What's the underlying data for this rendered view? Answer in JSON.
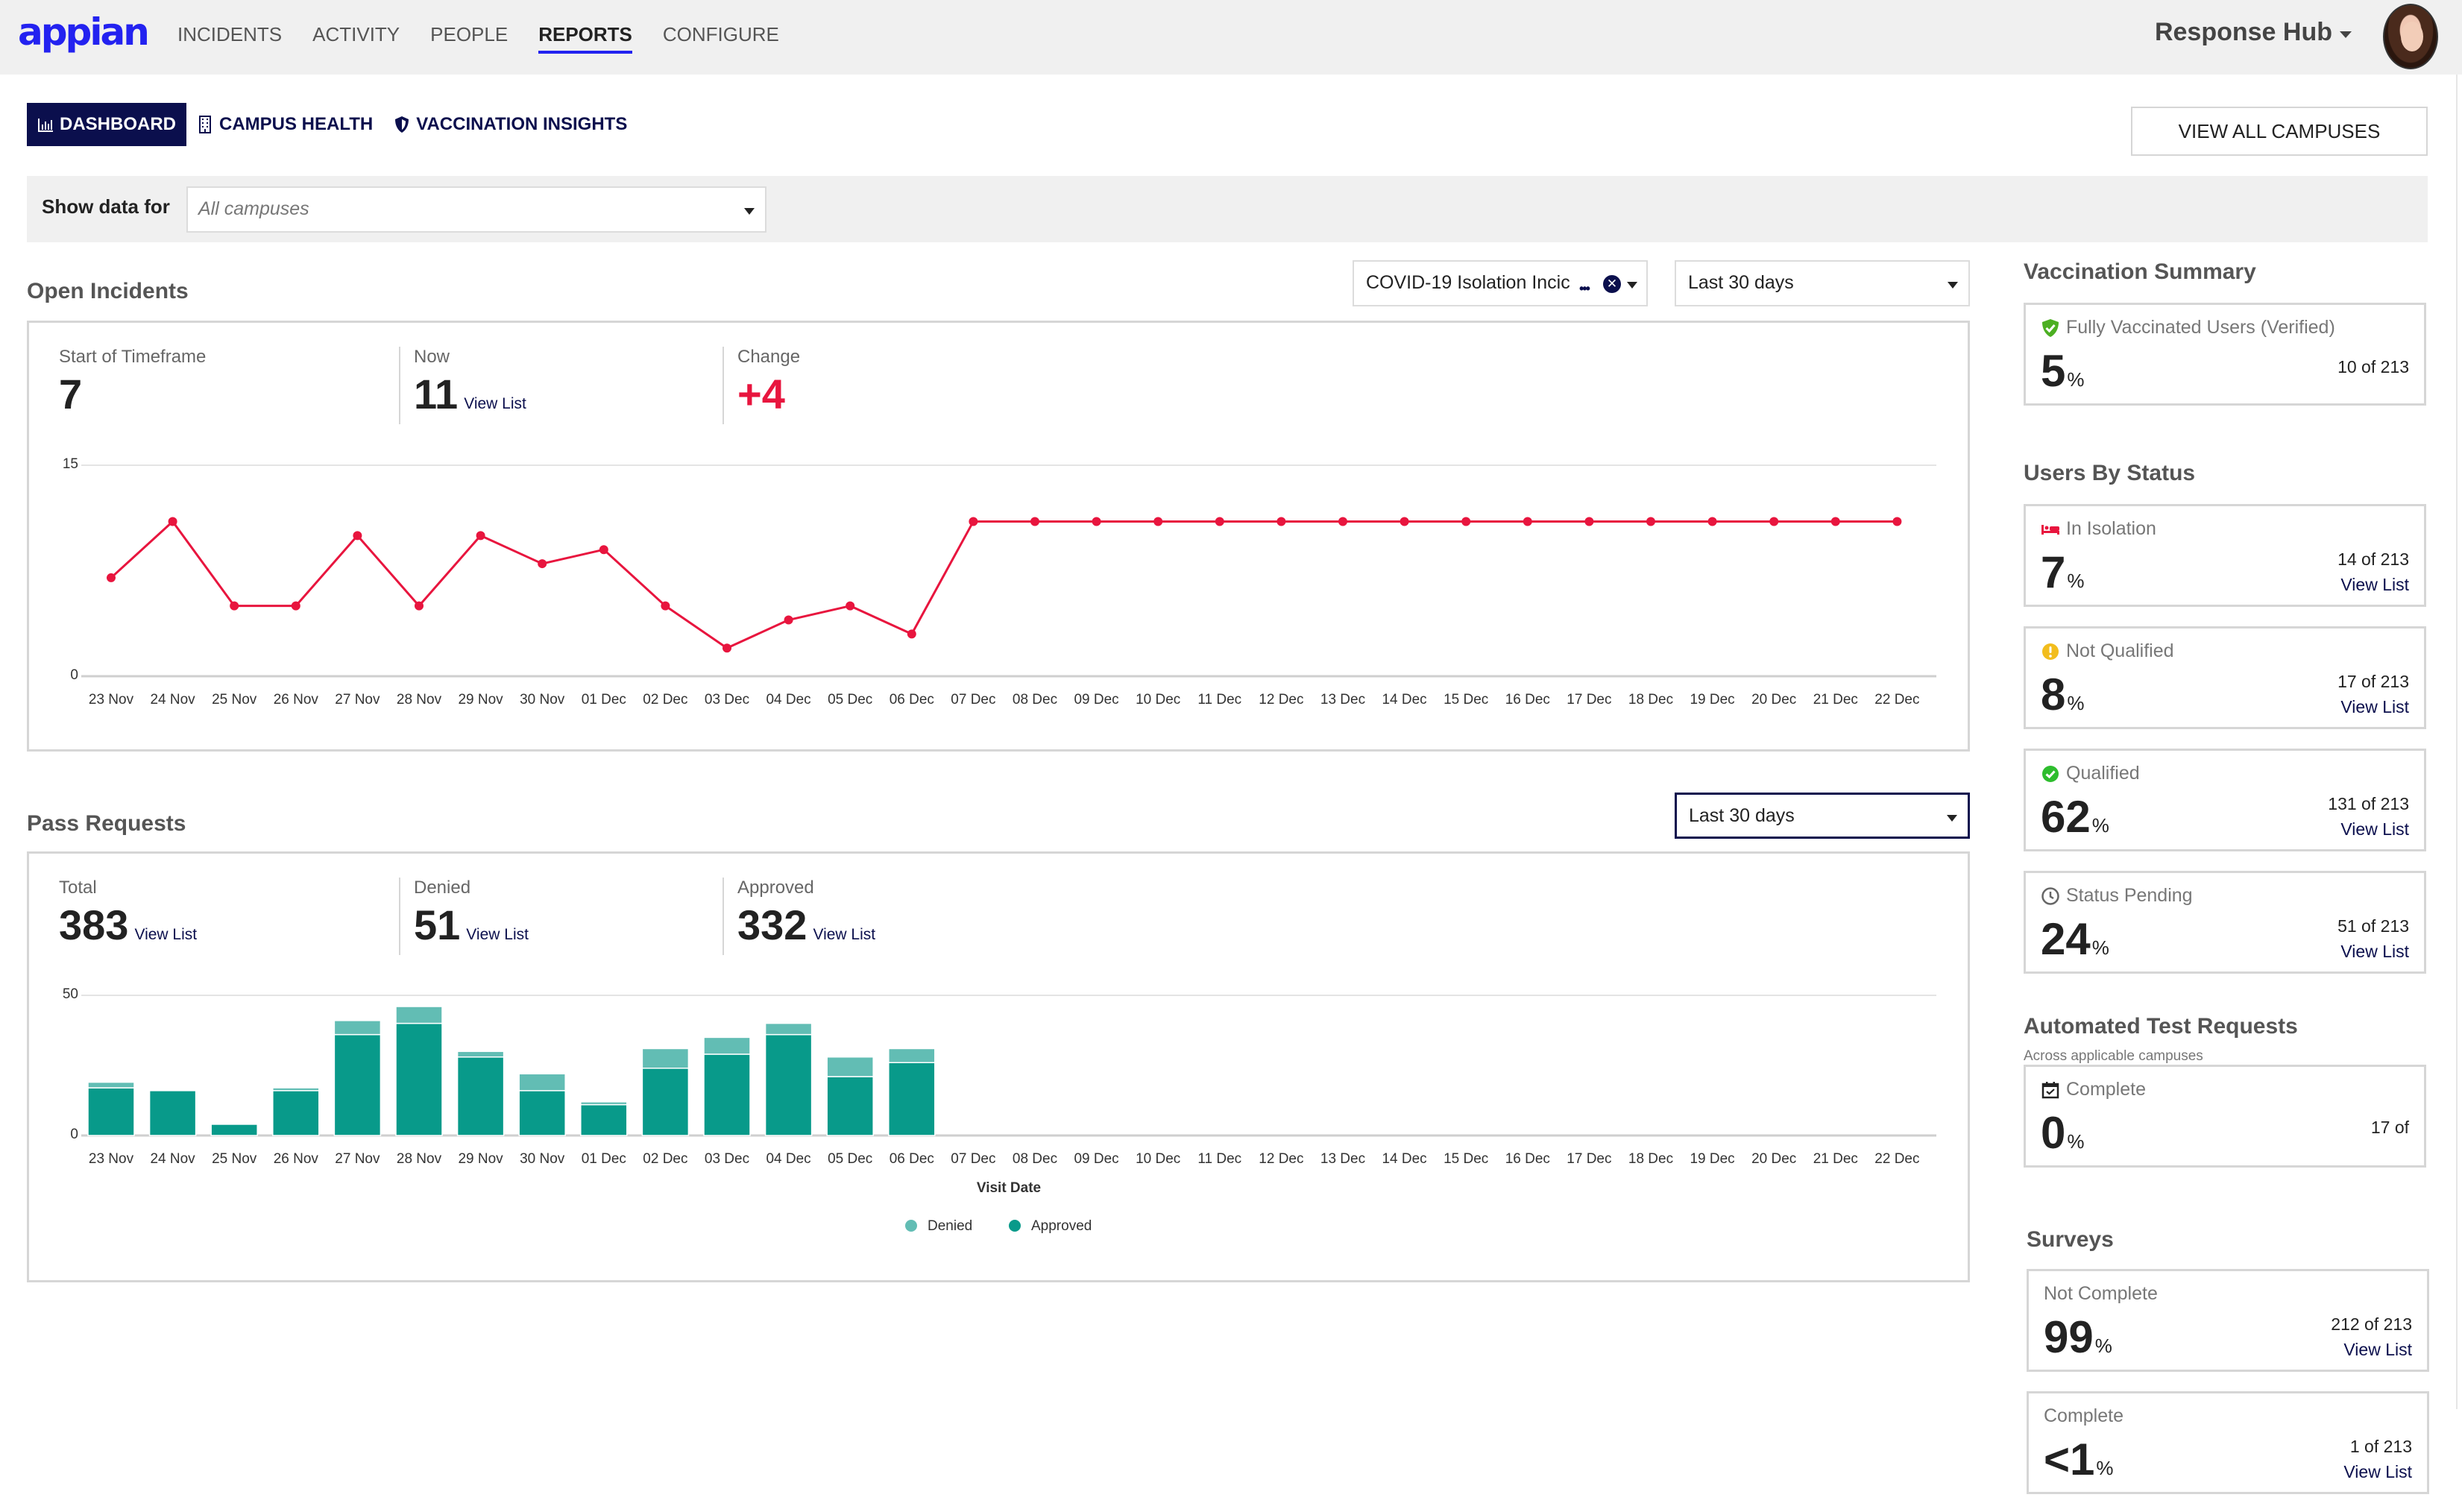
{
  "header": {
    "logo": "appian",
    "nav": [
      "INCIDENTS",
      "ACTIVITY",
      "PEOPLE",
      "REPORTS",
      "CONFIGURE"
    ],
    "active_nav": "REPORTS",
    "app_name": "Response Hub",
    "brand_color": "#2322f0"
  },
  "tabs": [
    {
      "label": "DASHBOARD",
      "icon": "bar-chart-icon",
      "active": true
    },
    {
      "label": "CAMPUS HEALTH",
      "icon": "building-icon",
      "active": false
    },
    {
      "label": "VACCINATION INSIGHTS",
      "icon": "shield-icon",
      "active": false
    }
  ],
  "view_all_button": "VIEW ALL CAMPUSES",
  "filter": {
    "label": "Show data for",
    "placeholder": "All campuses"
  },
  "open_incidents": {
    "title": "Open Incidents",
    "type_dropdown": "COVID-19 Isolation Incic",
    "range_dropdown": "Last 30 days",
    "kpis": {
      "start_label": "Start of Timeframe",
      "start_value": "7",
      "now_label": "Now",
      "now_value": "11",
      "now_link": "View List",
      "change_label": "Change",
      "change_value": "+4"
    }
  },
  "pass_requests": {
    "title": "Pass Requests",
    "range_dropdown": "Last 30 days",
    "kpis": {
      "total_label": "Total",
      "total_value": "383",
      "denied_label": "Denied",
      "denied_value": "51",
      "approved_label": "Approved",
      "approved_value": "332",
      "link": "View List"
    }
  },
  "chart_data": [
    {
      "type": "line",
      "title": "Open Incidents",
      "categories": [
        "23 Nov",
        "24 Nov",
        "25 Nov",
        "26 Nov",
        "27 Nov",
        "28 Nov",
        "29 Nov",
        "30 Nov",
        "01 Dec",
        "02 Dec",
        "03 Dec",
        "04 Dec",
        "05 Dec",
        "06 Dec",
        "07 Dec",
        "08 Dec",
        "09 Dec",
        "10 Dec",
        "11 Dec",
        "12 Dec",
        "13 Dec",
        "14 Dec",
        "15 Dec",
        "16 Dec",
        "17 Dec",
        "18 Dec",
        "19 Dec",
        "20 Dec",
        "21 Dec",
        "22 Dec"
      ],
      "series": [
        {
          "name": "Open Incidents",
          "color": "#e8153e",
          "values": [
            7,
            11,
            5,
            5,
            10,
            5,
            10,
            8,
            9,
            5,
            2,
            4,
            5,
            3,
            11,
            11,
            11,
            11,
            11,
            11,
            11,
            11,
            11,
            11,
            11,
            11,
            11,
            11,
            11,
            11
          ]
        }
      ],
      "yticks": [
        0,
        15
      ],
      "ylim": [
        0,
        15
      ],
      "grid": true,
      "xlabel": "",
      "ylabel": ""
    },
    {
      "type": "bar",
      "stacked": true,
      "title": "Pass Requests",
      "categories": [
        "23 Nov",
        "24 Nov",
        "25 Nov",
        "26 Nov",
        "27 Nov",
        "28 Nov",
        "29 Nov",
        "30 Nov",
        "01 Dec",
        "02 Dec",
        "03 Dec",
        "04 Dec",
        "05 Dec",
        "06 Dec",
        "07 Dec",
        "08 Dec",
        "09 Dec",
        "10 Dec",
        "11 Dec",
        "12 Dec",
        "13 Dec",
        "14 Dec",
        "15 Dec",
        "16 Dec",
        "17 Dec",
        "18 Dec",
        "19 Dec",
        "20 Dec",
        "21 Dec",
        "22 Dec"
      ],
      "series": [
        {
          "name": "Approved",
          "color": "#089a8a",
          "values": [
            17,
            16,
            4,
            16,
            36,
            40,
            28,
            16,
            11,
            24,
            29,
            36,
            21,
            26,
            0,
            0,
            0,
            0,
            0,
            0,
            0,
            0,
            0,
            0,
            0,
            0,
            0,
            0,
            0,
            0
          ]
        },
        {
          "name": "Denied",
          "color": "#62bdb4",
          "values": [
            2,
            0,
            0,
            1,
            5,
            6,
            2,
            6,
            1,
            7,
            6,
            4,
            7,
            5,
            0,
            0,
            0,
            0,
            0,
            0,
            0,
            0,
            0,
            0,
            0,
            0,
            0,
            0,
            0,
            0
          ]
        }
      ],
      "yticks": [
        0,
        50
      ],
      "ylim": [
        0,
        50
      ],
      "grid": true,
      "xlabel": "Visit Date",
      "ylabel": "",
      "legend": [
        "Denied",
        "Approved"
      ],
      "legend_position": "bottom-center"
    }
  ],
  "right_panel": {
    "vaccination": {
      "title": "Vaccination Summary",
      "card": {
        "label": "Fully Vaccinated Users (Verified)",
        "icon": "shield-check-icon",
        "pct": "5",
        "count": "10 of 213"
      }
    },
    "users_by_status": {
      "title": "Users By Status",
      "cards": [
        {
          "label": "In Isolation",
          "icon": "bed-icon",
          "pct": "7",
          "count": "14 of 213",
          "link": "View List"
        },
        {
          "label": "Not Qualified",
          "icon": "warning-icon",
          "pct": "8",
          "count": "17 of 213",
          "link": "View List"
        },
        {
          "label": "Qualified",
          "icon": "check-circle-icon",
          "pct": "62",
          "count": "131 of 213",
          "link": "View List"
        },
        {
          "label": "Status Pending",
          "icon": "clock-icon",
          "pct": "24",
          "count": "51 of 213",
          "link": "View List"
        }
      ]
    },
    "automated_tests": {
      "title": "Automated Test Requests",
      "subtitle": "Across applicable campuses",
      "card": {
        "label": "Complete",
        "icon": "calendar-check-icon",
        "pct": "0",
        "count": "17 of"
      }
    },
    "surveys": {
      "title": "Surveys",
      "cards": [
        {
          "label": "Not Complete",
          "pct": "99",
          "count": "212 of 213",
          "link": "View List"
        },
        {
          "label": "Complete",
          "pct": "<1",
          "count": "1 of 213",
          "link": "View List"
        }
      ]
    },
    "pct_symbol": "%"
  }
}
